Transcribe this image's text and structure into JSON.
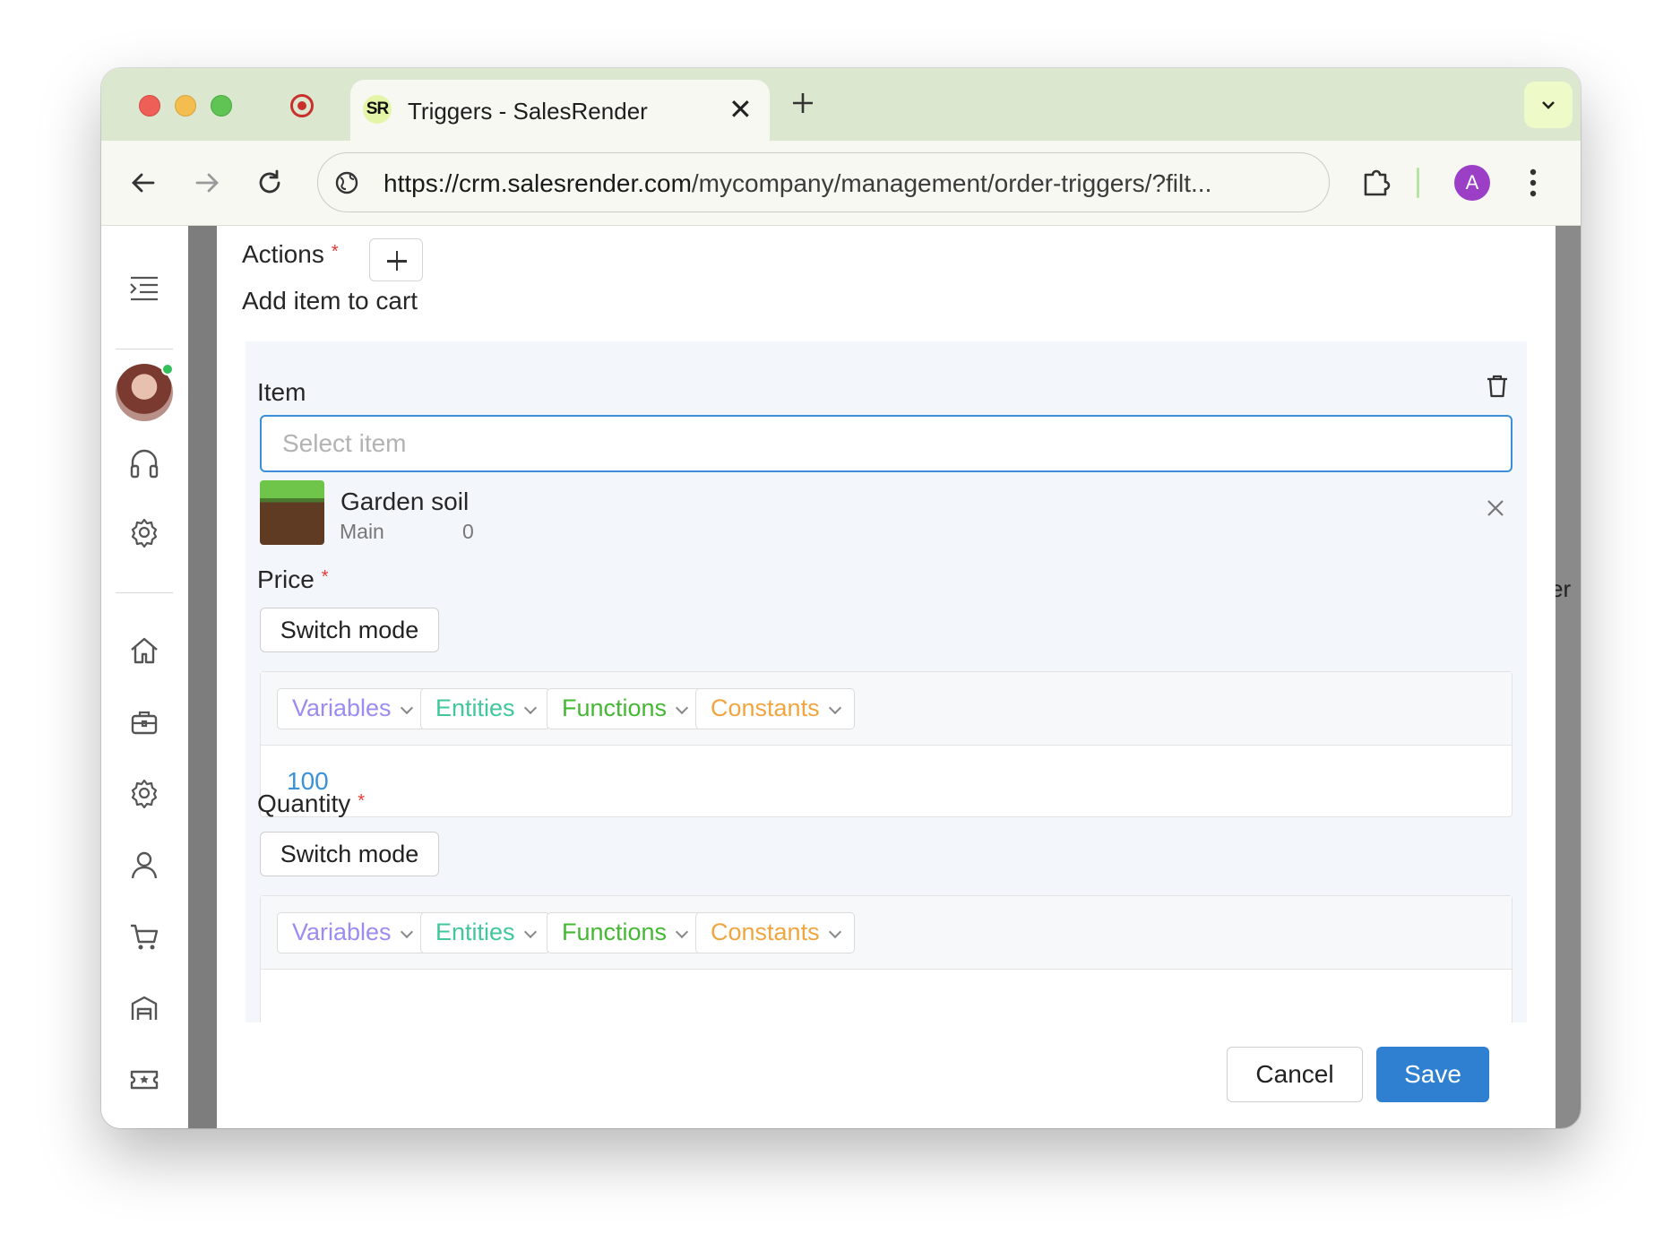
{
  "browser": {
    "tab_title": "Triggers - SalesRender",
    "tab_favicon": "SR",
    "url_host": "https://crm.salesrender.com",
    "url_path": "/mycompany/management/order-triggers/?filt...",
    "profile_initial": "A",
    "icons": [
      "record-icon",
      "close-icon",
      "plus-icon",
      "chevron-down-icon",
      "back-arrow-icon",
      "forward-arrow-icon",
      "reload-icon",
      "globe-icon",
      "extensions-icon",
      "kebab-menu-icon"
    ]
  },
  "sidebar": {
    "icons": [
      "menu-collapse-icon",
      "headset-icon",
      "gear-icon",
      "home-icon",
      "briefcase-icon",
      "gear-icon",
      "user-icon",
      "cart-icon",
      "warehouse-icon",
      "ticket-icon"
    ]
  },
  "background_hint": {
    "text": "er"
  },
  "modal": {
    "actions_label": "Actions",
    "action_title": "Add item to cart",
    "item": {
      "label": "Item",
      "placeholder": "Select item",
      "selected": {
        "name": "Garden soil",
        "warehouse": "Main",
        "quantity": "0"
      }
    },
    "price": {
      "label": "Price",
      "switch_mode": "Switch mode",
      "chips": {
        "variables": "Variables",
        "entities": "Entities",
        "functions": "Functions",
        "constants": "Constants"
      },
      "value": "100"
    },
    "quantity": {
      "label": "Quantity",
      "switch_mode": "Switch mode",
      "chips": {
        "variables": "Variables",
        "entities": "Entities",
        "functions": "Functions",
        "constants": "Constants"
      }
    },
    "cancel_label": "Cancel",
    "save_label": "Save"
  },
  "colors": {
    "primary": "#2f80d1",
    "required": "#e53935",
    "variables": "#9b8cf2",
    "entities": "#41c79b",
    "functions": "#45b833",
    "constants": "#f0a640"
  }
}
